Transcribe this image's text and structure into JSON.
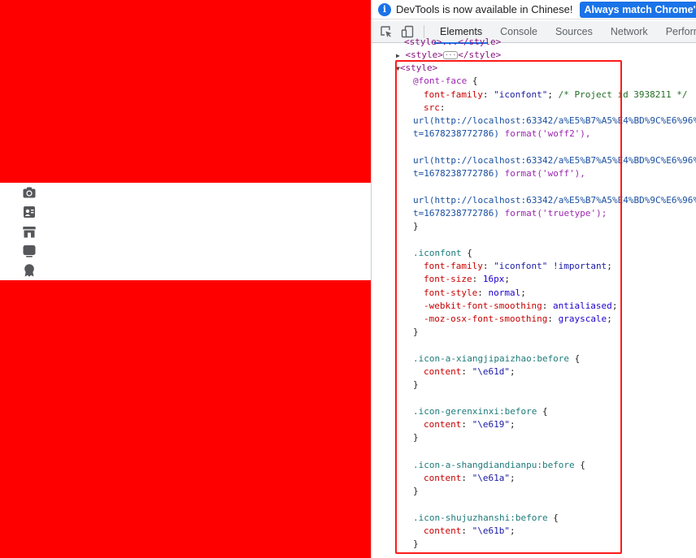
{
  "left_icons": [
    "camera-icon",
    "contact-card-icon",
    "store-icon",
    "monitor-icon",
    "award-icon"
  ],
  "colors": {
    "page_background": "#ff0000",
    "band": "#ffffff",
    "icon": "#55575b",
    "accent": "#1a73e8",
    "highlight": "#ff1a1a"
  },
  "infobar": {
    "text": "DevTools is now available in Chinese!",
    "button": "Always match Chrome's langua"
  },
  "tabs": [
    "Elements",
    "Console",
    "Sources",
    "Network",
    "Performa"
  ],
  "code": {
    "l0": "<style>...</style>",
    "l1_open": "<style>",
    "l1_close": "</style>",
    "l2": "<style>",
    "fontface_at": "@font-face",
    "fontface_open": " {",
    "ff_prop": "font-family",
    "ff_val": "\"iconfont\"",
    "ff_comment": "/* Project id 3938211 */",
    "src_prop": "src",
    "url1": "url(http://localhost:63342/a%E5%B7%A5%E4%BD%9C%E6%96%",
    "t1": "t=1678238772786)",
    "fmt1": "format('woff2'),",
    "url2": "url(http://localhost:63342/a%E5%B7%A5%E4%BD%9C%E6%96%",
    "t2": "t=1678238772786)",
    "fmt2": "format('woff'),",
    "url3": "url(http://localhost:63342/a%E5%B7%A5%E4%BD%9C%E6%96%",
    "t3": "t=1678238772786)",
    "fmt3": "format('truetype');",
    "close": "}",
    "iconfont_sel": ".iconfont",
    "if_ff_prop": "font-family",
    "if_ff_val": "\"iconfont\" !important",
    "if_fs_prop": "font-size",
    "if_fs_val": "16px",
    "if_fst_prop": "font-style",
    "if_fst_val": "normal",
    "if_wk_prop": "-webkit-font-smoothing",
    "if_wk_val": "antialiased",
    "if_moz_prop": "-moz-osx-font-smoothing",
    "if_moz_val": "grayscale",
    "sel1": ".icon-a-xiangjipaizhao:before",
    "c1": "\"\\e61d\"",
    "sel2": ".icon-gerenxinxi:before",
    "c2": "\"\\e619\"",
    "sel3": ".icon-a-shangdiandianpu:before",
    "c3": "\"\\e61a\"",
    "sel4": ".icon-shujuzhanshi:before",
    "c4": "\"\\e61b\"",
    "content_prop": "content"
  }
}
